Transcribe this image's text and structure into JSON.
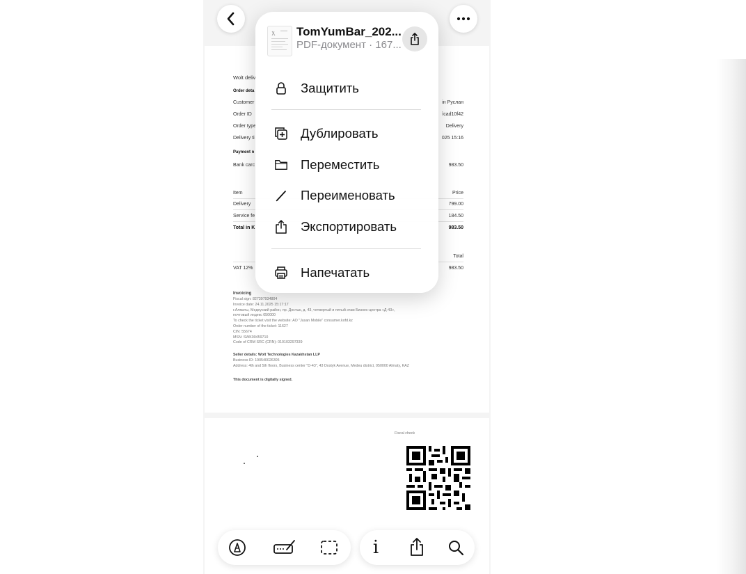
{
  "menu": {
    "file_name": "TomYumBar_202...",
    "file_info": "PDF-документ · 167...",
    "items": [
      {
        "label": "Защитить",
        "icon": "lock-icon"
      },
      {
        "label": "Дублировать",
        "icon": "duplicate-icon"
      },
      {
        "label": "Переместить",
        "icon": "folder-icon"
      },
      {
        "label": "Переименовать",
        "icon": "pencil-icon"
      },
      {
        "label": "Экспортировать",
        "icon": "export-icon"
      },
      {
        "label": "Напечатать",
        "icon": "printer-icon"
      }
    ]
  },
  "document": {
    "title": "Wolt deliv",
    "order_details_label": "Order deta",
    "rows": [
      {
        "label": "Customer",
        "value": "ін Руслан"
      },
      {
        "label": "Order ID",
        "value": "ìcad10f42"
      },
      {
        "label": "Order type",
        "value": "Delivery"
      },
      {
        "label": "Delivery ti",
        "value": "025 15:16"
      }
    ],
    "payment_label": "Payment n",
    "payment_row": {
      "label": "Bank carc",
      "value": "983.50"
    },
    "items_header": {
      "label": "Item",
      "value": "Price"
    },
    "items": [
      {
        "label": "Delivery",
        "value": "799.00"
      },
      {
        "label": "Service fe",
        "value": "184.50"
      }
    ],
    "total_row": {
      "label": "Total in K",
      "value": "983.50"
    },
    "vat_header": "Total",
    "vat_row": {
      "label": "VAT 12%",
      "value": "983.50"
    },
    "invoicing_title": "Invoicing",
    "invoicing_lines": [
      "Fiscal sign: 827397934804",
      "Invoice date: 24.11.2025 15:17:17",
      "г.Алматы, Медеуский район, пр. Достык, д. 43, четвертый и пятый этаж Бизнес-центра «Д-43»,",
      "почтовый индекс 050000",
      "To check the ticket visit the website: AO \"Jusan Mobile\" consumer.kofd.kz",
      "Order number of the ticket: 11627",
      "CIN: 55674",
      "MSN: SWK00459710",
      "Code of CRM SRC (CRN): 010103297339"
    ],
    "seller_title": "Seller details: Wolt Technologies Kazakhstan LLP",
    "seller_lines": [
      "Business ID: 190540026305",
      "Address: 4th and 5th floors, Business center \"D-43\", 43 Dostyk Avenue, Medeu district, 050000 Almaty, KAZ"
    ],
    "signed_note": "This document is digitally signed.",
    "fiscal_check_label": "Fiscal check"
  },
  "nav": {
    "back_icon": "chevron-left-icon",
    "more_icon": "ellipsis-icon"
  },
  "toolbar": {
    "left": [
      "markup-icon",
      "signature-icon",
      "select-area-icon"
    ],
    "right": [
      "info-icon",
      "share-icon",
      "search-icon"
    ],
    "info_glyph": "i"
  }
}
